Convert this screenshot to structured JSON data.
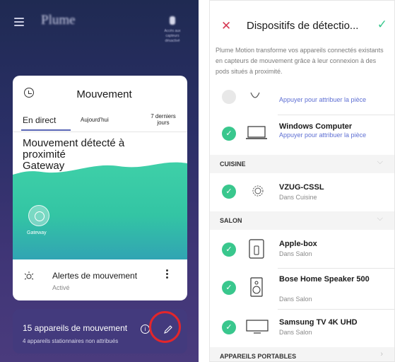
{
  "left_screen": {
    "brand": "Plume",
    "top_right_label": "Accès aux capteurs désactivé",
    "card": {
      "title": "Mouvement",
      "tabs": [
        "En direct",
        "Aujourd'hui",
        "7 derniers jours"
      ],
      "status_line": "Mouvement détecté à proximité",
      "status_location": "Gateway",
      "gateway_label": "Gateway",
      "alert_title": "Alertes de mouvement",
      "alert_status": "Activé"
    },
    "bottom_card": {
      "title": "15 appareils de mouvement",
      "subtitle": "4 appareils stationnaires non attribués",
      "info_glyph": "i"
    }
  },
  "right_screen": {
    "close_glyph": "✕",
    "title": "Dispositifs de détectio...",
    "confirm_glyph": "✓",
    "description": "Plume Motion transforme vos appareils connectés existants en capteurs de mouvement grâce à leur connexion à des pods situés à proximité.",
    "partial_item": {
      "assign": "Appuyer pour attribuer la pièce"
    },
    "items_unassigned": [
      {
        "name": "Windows Computer",
        "assign": "Appuyer pour attribuer la pièce",
        "icon": "laptop-icon"
      }
    ],
    "sections": [
      {
        "label": "CUISINE",
        "chevron": "⌵",
        "items": [
          {
            "name": "VZUG-CSSL",
            "room": "Dans Cuisine",
            "icon": "sensor-icon"
          }
        ]
      },
      {
        "label": "SALON",
        "chevron": "⌵",
        "items": [
          {
            "name": "Apple-box",
            "room": "Dans Salon",
            "icon": "tv-box-icon"
          },
          {
            "name": "Bose Home Speaker 500",
            "room": "Dans Salon",
            "icon": "speaker-icon"
          },
          {
            "name": "Samsung TV 4K UHD",
            "room": "Dans Salon",
            "icon": "tv-icon"
          }
        ]
      },
      {
        "label": "APPAREILS PORTABLES",
        "chevron": "›",
        "items": []
      }
    ],
    "check_glyph": "✓"
  },
  "colors": {
    "accent_green": "#39c78d",
    "accent_red": "#e3262b",
    "link_blue": "#5e6fd3",
    "card_purple": "#433a7d"
  }
}
